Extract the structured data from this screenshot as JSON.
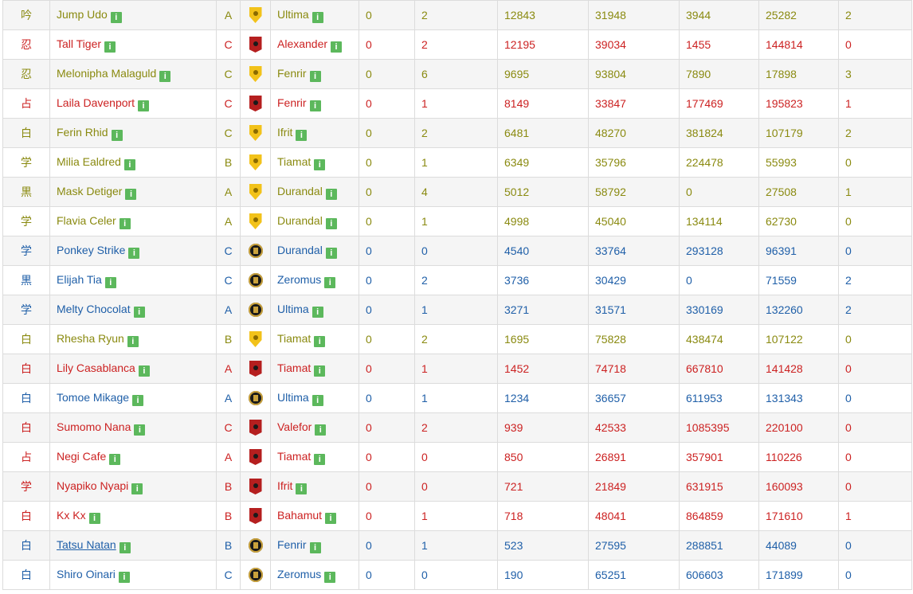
{
  "info_icon_glyph": "i",
  "colors": {
    "red": "#cc2222",
    "olive": "#8a8a10",
    "blue": "#1f5fa8",
    "info_green": "#5cb85c"
  },
  "rows": [
    {
      "job": "吟",
      "name": "Jump Udo",
      "rank": "A",
      "gc": "adders",
      "world": "Ultima",
      "v1": "0",
      "v2": "2",
      "v3": "12843",
      "v4": "31948",
      "v5": "3944",
      "v6": "25282",
      "v7": "2",
      "color": "olive"
    },
    {
      "job": "忍",
      "name": "Tall Tiger",
      "rank": "C",
      "gc": "maelstrom",
      "world": "Alexander",
      "v1": "0",
      "v2": "2",
      "v3": "12195",
      "v4": "39034",
      "v5": "1455",
      "v6": "144814",
      "v7": "0",
      "color": "red"
    },
    {
      "job": "忍",
      "name": "Melonipha Malaguld",
      "rank": "C",
      "gc": "adders",
      "world": "Fenrir",
      "v1": "0",
      "v2": "6",
      "v3": "9695",
      "v4": "93804",
      "v5": "7890",
      "v6": "17898",
      "v7": "3",
      "color": "olive"
    },
    {
      "job": "占",
      "name": "Laila Davenport",
      "rank": "C",
      "gc": "maelstrom",
      "world": "Fenrir",
      "v1": "0",
      "v2": "1",
      "v3": "8149",
      "v4": "33847",
      "v5": "177469",
      "v6": "195823",
      "v7": "1",
      "color": "red"
    },
    {
      "job": "白",
      "name": "Ferin Rhid",
      "rank": "C",
      "gc": "adders",
      "world": "Ifrit",
      "v1": "0",
      "v2": "2",
      "v3": "6481",
      "v4": "48270",
      "v5": "381824",
      "v6": "107179",
      "v7": "2",
      "color": "olive"
    },
    {
      "job": "学",
      "name": "Milia Ealdred",
      "rank": "B",
      "gc": "adders",
      "world": "Tiamat",
      "v1": "0",
      "v2": "1",
      "v3": "6349",
      "v4": "35796",
      "v5": "224478",
      "v6": "55993",
      "v7": "0",
      "color": "olive"
    },
    {
      "job": "黒",
      "name": "Mask Detiger",
      "rank": "A",
      "gc": "adders",
      "world": "Durandal",
      "v1": "0",
      "v2": "4",
      "v3": "5012",
      "v4": "58792",
      "v5": "0",
      "v6": "27508",
      "v7": "1",
      "color": "olive"
    },
    {
      "job": "学",
      "name": "Flavia Celer",
      "rank": "A",
      "gc": "adders",
      "world": "Durandal",
      "v1": "0",
      "v2": "1",
      "v3": "4998",
      "v4": "45040",
      "v5": "134114",
      "v6": "62730",
      "v7": "0",
      "color": "olive"
    },
    {
      "job": "学",
      "name": "Ponkey Strike",
      "rank": "C",
      "gc": "flames",
      "world": "Durandal",
      "v1": "0",
      "v2": "0",
      "v3": "4540",
      "v4": "33764",
      "v5": "293128",
      "v6": "96391",
      "v7": "0",
      "color": "blue"
    },
    {
      "job": "黒",
      "name": "Elijah Tia",
      "rank": "C",
      "gc": "flames",
      "world": "Zeromus",
      "v1": "0",
      "v2": "2",
      "v3": "3736",
      "v4": "30429",
      "v5": "0",
      "v6": "71559",
      "v7": "2",
      "color": "blue"
    },
    {
      "job": "学",
      "name": "Melty Chocolat",
      "rank": "A",
      "gc": "flames",
      "world": "Ultima",
      "v1": "0",
      "v2": "1",
      "v3": "3271",
      "v4": "31571",
      "v5": "330169",
      "v6": "132260",
      "v7": "2",
      "color": "blue"
    },
    {
      "job": "白",
      "name": "Rhesha Ryun",
      "rank": "B",
      "gc": "adders",
      "world": "Tiamat",
      "v1": "0",
      "v2": "2",
      "v3": "1695",
      "v4": "75828",
      "v5": "438474",
      "v6": "107122",
      "v7": "0",
      "color": "olive"
    },
    {
      "job": "白",
      "name": "Lily Casablanca",
      "rank": "A",
      "gc": "maelstrom",
      "world": "Tiamat",
      "v1": "0",
      "v2": "1",
      "v3": "1452",
      "v4": "74718",
      "v5": "667810",
      "v6": "141428",
      "v7": "0",
      "color": "red"
    },
    {
      "job": "白",
      "name": "Tomoe Mikage",
      "rank": "A",
      "gc": "flames",
      "world": "Ultima",
      "v1": "0",
      "v2": "1",
      "v3": "1234",
      "v4": "36657",
      "v5": "611953",
      "v6": "131343",
      "v7": "0",
      "color": "blue"
    },
    {
      "job": "白",
      "name": "Sumomo Nana",
      "rank": "C",
      "gc": "maelstrom",
      "world": "Valefor",
      "v1": "0",
      "v2": "2",
      "v3": "939",
      "v4": "42533",
      "v5": "1085395",
      "v6": "220100",
      "v7": "0",
      "color": "red"
    },
    {
      "job": "占",
      "name": "Negi Cafe",
      "rank": "A",
      "gc": "maelstrom",
      "world": "Tiamat",
      "v1": "0",
      "v2": "0",
      "v3": "850",
      "v4": "26891",
      "v5": "357901",
      "v6": "110226",
      "v7": "0",
      "color": "red"
    },
    {
      "job": "学",
      "name": "Nyapiko Nyapi",
      "rank": "B",
      "gc": "maelstrom",
      "world": "Ifrit",
      "v1": "0",
      "v2": "0",
      "v3": "721",
      "v4": "21849",
      "v5": "631915",
      "v6": "160093",
      "v7": "0",
      "color": "red"
    },
    {
      "job": "白",
      "name": "Kx Kx",
      "rank": "B",
      "gc": "maelstrom",
      "world": "Bahamut",
      "v1": "0",
      "v2": "1",
      "v3": "718",
      "v4": "48041",
      "v5": "864859",
      "v6": "171610",
      "v7": "1",
      "color": "red"
    },
    {
      "job": "白",
      "name": "Tatsu Natan",
      "rank": "B",
      "gc": "flames",
      "world": "Fenrir",
      "v1": "0",
      "v2": "1",
      "v3": "523",
      "v4": "27595",
      "v5": "288851",
      "v6": "44089",
      "v7": "0",
      "color": "blue",
      "underline": true
    },
    {
      "job": "白",
      "name": "Shiro Oinari",
      "rank": "C",
      "gc": "flames",
      "world": "Zeromus",
      "v1": "0",
      "v2": "0",
      "v3": "190",
      "v4": "65251",
      "v5": "606603",
      "v6": "171899",
      "v7": "0",
      "color": "blue"
    }
  ]
}
